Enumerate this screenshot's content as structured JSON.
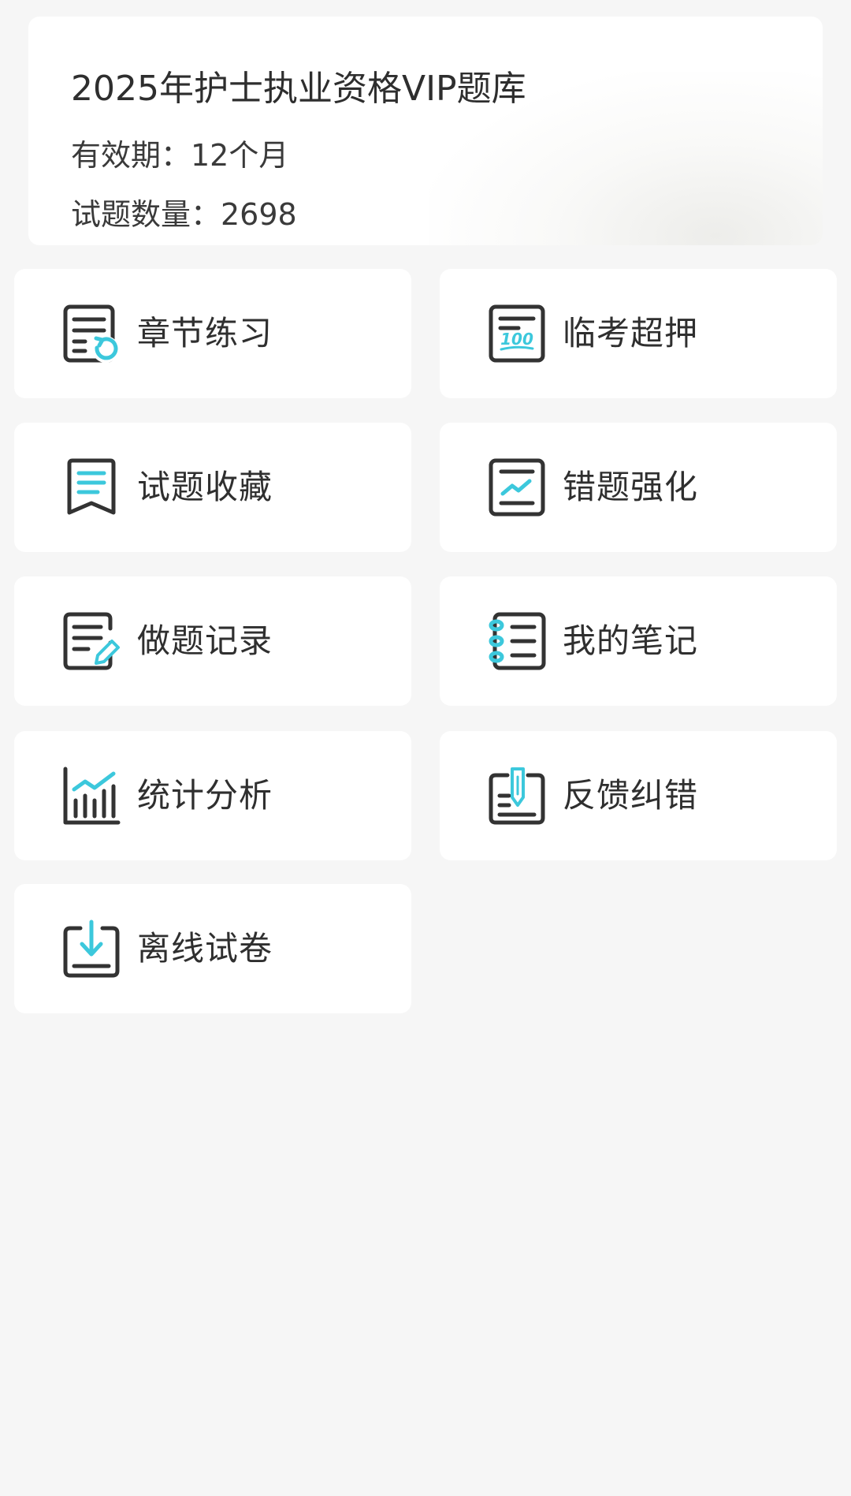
{
  "card": {
    "title": "2025年护士执业资格VIP题库",
    "validity": "有效期：12个月",
    "question_count": "试题数量：2698"
  },
  "menu": [
    {
      "label": "章节练习",
      "icon": "chapter-practice-icon"
    },
    {
      "label": "临考超押",
      "icon": "exam-predict-icon"
    },
    {
      "label": "试题收藏",
      "icon": "bookmark-icon"
    },
    {
      "label": "错题强化",
      "icon": "wrong-questions-icon"
    },
    {
      "label": "做题记录",
      "icon": "practice-record-icon"
    },
    {
      "label": "我的笔记",
      "icon": "notebook-icon"
    },
    {
      "label": "统计分析",
      "icon": "statistics-icon"
    },
    {
      "label": "反馈纠错",
      "icon": "feedback-icon"
    },
    {
      "label": "离线试卷",
      "icon": "offline-download-icon"
    }
  ],
  "colors": {
    "background": "#f6f6f6",
    "card": "#ffffff",
    "accent": "#3cc8dc",
    "icon_stroke": "#333333",
    "text": "#333333"
  }
}
